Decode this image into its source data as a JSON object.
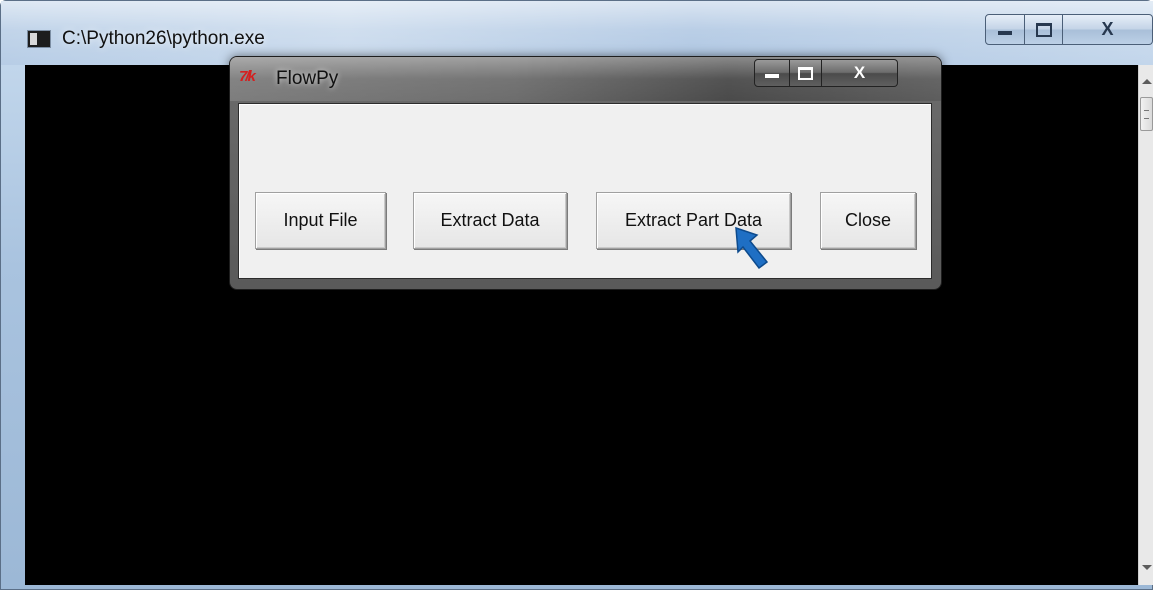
{
  "console": {
    "title": "C:\\Python26\\python.exe",
    "caption_close": "X"
  },
  "dialog": {
    "title": "FlowPy",
    "icon_text": "7/k",
    "caption_close": "X",
    "buttons": {
      "input_file": "Input File",
      "extract_data": "Extract Data",
      "extract_part_data": "Extract Part Data",
      "close": "Close"
    }
  },
  "colors": {
    "console_background": "#000000",
    "dialog_background": "#f0f0f0",
    "pointer": "#1f6fc4"
  },
  "pointer": {
    "icon": "mouse-pointer-icon"
  }
}
